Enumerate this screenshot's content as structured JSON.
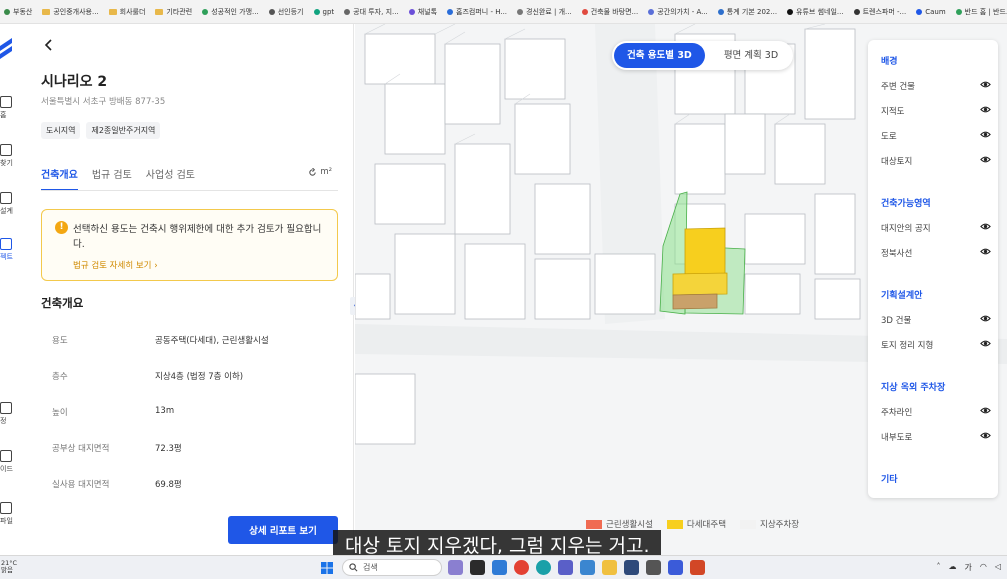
{
  "bookmarks": [
    {
      "label": "부동산",
      "icon": "site-icon",
      "color": "#3a8b4a"
    },
    {
      "label": "공인중개사용...",
      "icon": "folder-icon"
    },
    {
      "label": "회사룰더",
      "icon": "folder-icon"
    },
    {
      "label": "기타관련",
      "icon": "folder-icon"
    },
    {
      "label": "성공적인 가맹...",
      "icon": "site-icon",
      "color": "#2fa05a"
    },
    {
      "label": "선인등기",
      "icon": "site-icon",
      "color": "#555555"
    },
    {
      "label": "gpt",
      "icon": "site-icon",
      "color": "#10a37f"
    },
    {
      "label": "공대 투자, 지...",
      "icon": "site-icon",
      "color": "#666666"
    },
    {
      "label": "채널톡",
      "icon": "site-icon",
      "color": "#6b4fd8"
    },
    {
      "label": "홈즈컴퍼니 - H...",
      "icon": "site-icon",
      "color": "#2a6dd9"
    },
    {
      "label": "경신완료 | 개...",
      "icon": "site-icon",
      "color": "#777777"
    },
    {
      "label": "건축물 바탕면...",
      "icon": "site-icon",
      "color": "#e04a3f"
    },
    {
      "label": "공간의가치 - A...",
      "icon": "site-icon",
      "color": "#5a6fd8"
    },
    {
      "label": "통계 기본 202...",
      "icon": "site-icon",
      "color": "#2d6fcc"
    },
    {
      "label": "유튜브 썸네일...",
      "icon": "site-icon",
      "color": "#111111"
    },
    {
      "label": "트렌스파머 -...",
      "icon": "site-icon",
      "color": "#333333"
    },
    {
      "label": "Caum",
      "icon": "site-icon",
      "color": "#1f57e7"
    },
    {
      "label": "반드 홈 | 반드...",
      "icon": "site-icon",
      "color": "#2fa05a"
    }
  ],
  "rail": {
    "items": [
      {
        "label": "홈",
        "icon": "home-icon"
      },
      {
        "label": "찾기",
        "icon": "sparkle-search-icon"
      },
      {
        "label": "설계",
        "icon": "pencil-icon"
      },
      {
        "label": "젝트",
        "icon": "project-grid-icon",
        "active": true
      },
      {
        "label": "정",
        "icon": "user-icon"
      },
      {
        "label": "이드",
        "icon": "book-icon"
      },
      {
        "label": "파일",
        "icon": "file-badge-icon"
      }
    ]
  },
  "panel": {
    "title": "시나리오 2",
    "address": "서울특별시 서초구 방배동 877-35",
    "chips": [
      "도시지역",
      "제2종일반주거지역"
    ],
    "tabs": [
      {
        "label": "건축개요",
        "active": true
      },
      {
        "label": "법규 검토",
        "active": false
      },
      {
        "label": "사업성 검토",
        "active": false
      }
    ],
    "unit_label": "m²",
    "alert": {
      "message": "선택하신 용도는 건축시 행위제한에 대한 추가 검토가 필요합니다.",
      "link": "법규 검토 자세히 보기"
    },
    "section_title": "건축개요",
    "rows": [
      {
        "key": "용도",
        "value": "공동주택(다세대), 근린생활시설"
      },
      {
        "key": "층수",
        "value": "지상4층 (법정 7층 이하)"
      },
      {
        "key": "높이",
        "value": "13m"
      },
      {
        "key": "공부상 대지면적",
        "value": "72.3평"
      },
      {
        "key": "실사용 대지면적",
        "value": "69.8평"
      }
    ],
    "report_button": "상세 리포트 보기"
  },
  "map": {
    "modes": [
      {
        "label": "건축 용도별 3D",
        "active": true
      },
      {
        "label": "평면 계획 3D",
        "active": false
      }
    ],
    "layer_groups": [
      {
        "title": "배경",
        "items": [
          "주변 건물",
          "지적도",
          "도로",
          "대상토지"
        ]
      },
      {
        "title": "건축가능영역",
        "items": [
          "대지안의 공지",
          "정북사선"
        ]
      },
      {
        "title": "기획설계안",
        "items": [
          "3D 건물",
          "토지 정리 지형"
        ]
      },
      {
        "title": "지상 옥외 주차장",
        "items": [
          "주차라인",
          "내부도로"
        ]
      },
      {
        "title": "기타",
        "items": []
      }
    ],
    "legend": [
      {
        "label": "근린생활시설",
        "color": "#f06b52"
      },
      {
        "label": "다세대주택",
        "color": "#f7cf1e"
      },
      {
        "label": "지상주차장",
        "color": "#f2f2f2"
      }
    ]
  },
  "subtitle": "대상 토지 지우겠다, 그럼 지우는 거고.",
  "taskbar": {
    "weather_temp": "21°C",
    "weather_desc": "맑음",
    "search_placeholder": "검색",
    "tray_ime": "가"
  },
  "colors": {
    "accent": "#1f57e7",
    "warning": "#f3a712",
    "building_yellow": "#f7cf1e",
    "buildable_green": "#8be08b"
  }
}
